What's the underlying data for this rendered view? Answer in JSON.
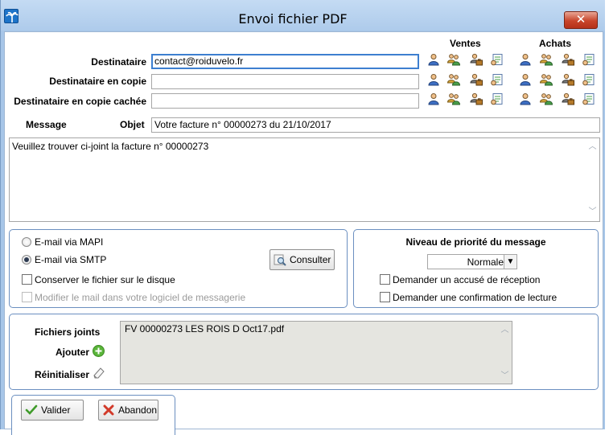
{
  "window": {
    "title": "Envoi fichier PDF",
    "close_glyph": "✕"
  },
  "header": {
    "ventes": "Ventes",
    "achats": "Achats"
  },
  "recipients": [
    {
      "label": "Destinataire",
      "value": "contact@roiduvelo.fr"
    },
    {
      "label": "Destinataire en copie",
      "value": ""
    },
    {
      "label": "Destinataire en copie cachée",
      "value": ""
    }
  ],
  "icons": [
    "person-icon",
    "group-icon",
    "company-icon",
    "contact-card-icon"
  ],
  "message": {
    "label": "Message",
    "subject_label": "Objet",
    "subject": "Votre facture n° 00000273 du 21/10/2017",
    "body": "Veuillez trouver ci-joint la facture n° 00000273"
  },
  "send": {
    "mapi": "E-mail via MAPI",
    "smtp": "E-mail via SMTP",
    "selected": "smtp",
    "consulter": "Consulter",
    "keep_file": "Conserver le fichier sur le disque",
    "modify_mail": "Modifier le mail dans votre logiciel de messagerie"
  },
  "priority": {
    "title": "Niveau de priorité du message",
    "value": "Normale",
    "receipt": "Demander un accusé de réception",
    "read_confirm": "Demander une confirmation de lecture"
  },
  "attachments": {
    "label": "Fichiers joints",
    "add": "Ajouter",
    "reset": "Réinitialiser",
    "files": [
      "FV 00000273 LES ROIS D Oct17.pdf"
    ]
  },
  "footer": {
    "validate": "Valider",
    "cancel": "Abandon"
  }
}
